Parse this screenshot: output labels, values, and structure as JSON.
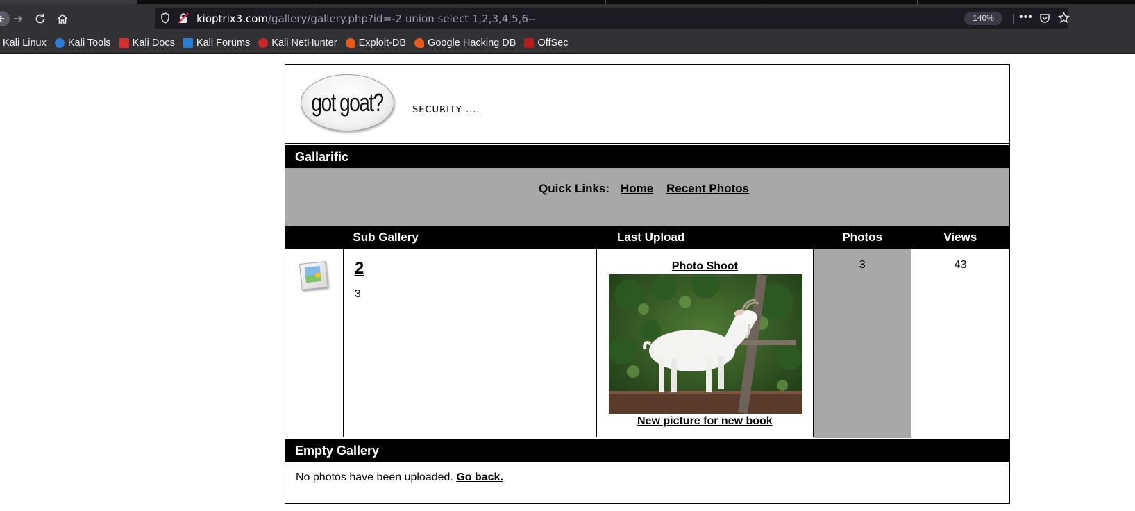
{
  "browser": {
    "url_host": "kioptrix3.com",
    "url_path": "/gallery/gallery.php?id=-2 union select 1,2,3,4,5,6--",
    "zoom": "140%",
    "bookmarks": [
      {
        "label": "Kali Linux",
        "icon": "kali-icon"
      },
      {
        "label": "Kali Tools",
        "icon": "kali-tools-icon"
      },
      {
        "label": "Kali Docs",
        "icon": "kali-docs-icon"
      },
      {
        "label": "Kali Forums",
        "icon": "kali-forums-icon"
      },
      {
        "label": "Kali NetHunter",
        "icon": "nethunter-icon"
      },
      {
        "label": "Exploit-DB",
        "icon": "exploit-db-icon"
      },
      {
        "label": "Google Hacking DB",
        "icon": "ghdb-icon"
      },
      {
        "label": "OffSec",
        "icon": "offsec-icon"
      }
    ]
  },
  "header": {
    "logo_text": "got goat?",
    "tagline": "SECURITY ...."
  },
  "gallery_bar": "Gallarific",
  "quick_links": {
    "label": "Quick Links:",
    "home": "Home",
    "recent": "Recent Photos"
  },
  "table": {
    "headers": [
      "",
      "Sub Gallery",
      "Last Upload",
      "Photos",
      "Views"
    ],
    "row": {
      "sub_title": "2",
      "sub_count": "3",
      "upload_title": "Photo Shoot",
      "upload_caption": "New picture for new book",
      "photos": "3",
      "views": "43"
    }
  },
  "empty": {
    "bar": "Empty Gallery",
    "message": "No photos have been uploaded.",
    "link": "Go back."
  }
}
